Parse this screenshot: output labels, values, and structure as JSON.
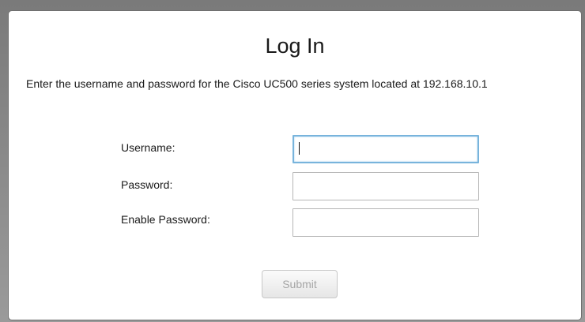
{
  "dialog": {
    "title": "Log In",
    "description": "Enter the username and password for the Cisco UC500 series system located at 192.168.10.1",
    "fields": {
      "username": {
        "label": "Username:",
        "value": ""
      },
      "password": {
        "label": "Password:",
        "value": ""
      },
      "enable_password": {
        "label": "Enable Password:",
        "value": ""
      }
    },
    "submit_label": "Submit"
  }
}
